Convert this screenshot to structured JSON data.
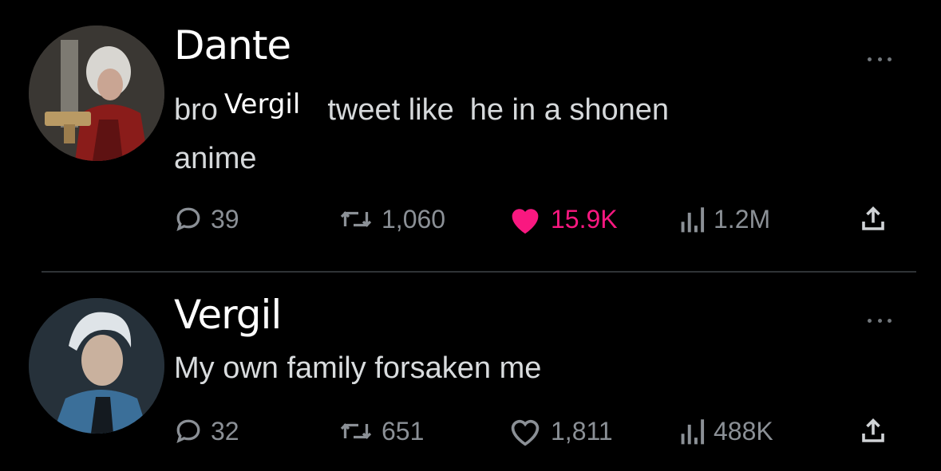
{
  "tweets": [
    {
      "author": "Dante",
      "body_parts": [
        "bro",
        "Vergil",
        "tweet like",
        "he in a shonen"
      ],
      "body_line2": "anime",
      "stats": {
        "replies": "39",
        "retweets": "1,060",
        "likes": "15.9K",
        "views": "1.2M"
      },
      "liked": true
    },
    {
      "author": "Vergil",
      "body": "My own family forsaken me",
      "stats": {
        "replies": "32",
        "retweets": "651",
        "likes": "1,811",
        "views": "488K"
      },
      "liked": false
    }
  ],
  "colors": {
    "background": "#000000",
    "like_pink": "#f91880",
    "muted": "#8b9096",
    "divider": "#2f3336"
  },
  "icons": [
    "reply-icon",
    "retweet-icon",
    "heart-icon",
    "views-icon",
    "share-icon",
    "more-icon"
  ]
}
